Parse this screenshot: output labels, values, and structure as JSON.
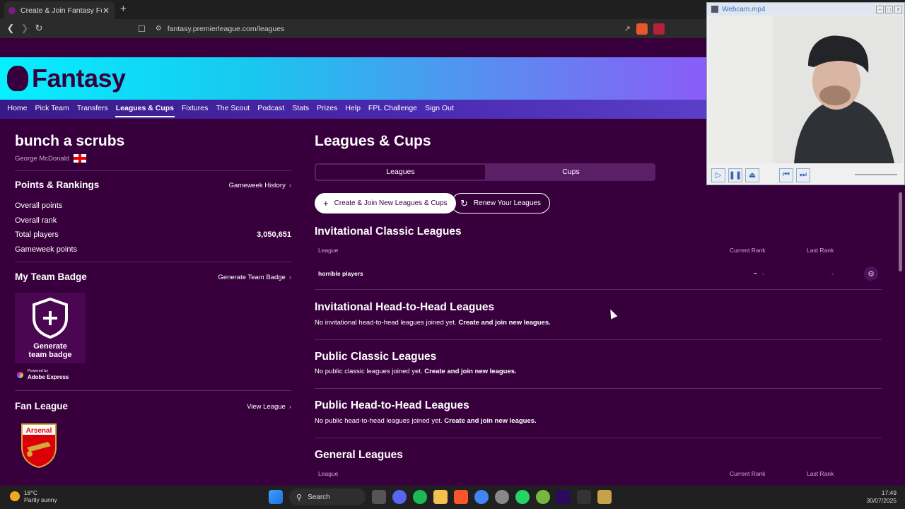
{
  "browser": {
    "tab_title": "Create & Join Fantasy Football L",
    "url": "fantasy.premierleague.com/leagues",
    "new_tab": "+",
    "close_tab": "✕"
  },
  "webcam": {
    "title": "Webcam.mp4"
  },
  "site": {
    "logo_text": "Fantasy",
    "nav": [
      "Home",
      "Pick Team",
      "Transfers",
      "Leagues & Cups",
      "Fixtures",
      "The Scout",
      "Podcast",
      "Stats",
      "Prizes",
      "Help",
      "FPL Challenge",
      "Sign Out"
    ],
    "nav_active": "Leagues & Cups",
    "brand_colors": {
      "purple": "#37003c",
      "cyan": "#05f0ff",
      "violet": "#8a5cf7"
    }
  },
  "left": {
    "team_name": "bunch a scrubs",
    "manager_name": "George McDonald",
    "points_heading": "Points & Rankings",
    "gameweek_history_link": "Gameweek History",
    "stats": [
      {
        "label": "Overall points",
        "value": ""
      },
      {
        "label": "Overall rank",
        "value": ""
      },
      {
        "label": "Total players",
        "value": "3,050,651"
      },
      {
        "label": "Gameweek points",
        "value": ""
      }
    ],
    "badge_heading": "My Team Badge",
    "badge_link": "Generate Team Badge",
    "badge_label_1": "Generate",
    "badge_label_2": "team badge",
    "adobe_1": "Powered by",
    "adobe_2": "Adobe Express",
    "fan_heading": "Fan League",
    "fan_link": "View League",
    "crest_text": "Arsenal"
  },
  "main": {
    "title": "Leagues & Cups",
    "tabs": [
      "Leagues",
      "Cups"
    ],
    "create_button": "Create & Join New Leagues & Cups",
    "renew_button": "Renew Your Leagues",
    "invitational_classic": {
      "heading": "Invitational Classic Leagues",
      "col_league": "League",
      "col_current": "Current Rank",
      "col_last": "Last Rank",
      "rows": [
        {
          "name": "horrible players",
          "current": "–",
          "current_change": "-",
          "last": "-"
        }
      ]
    },
    "invitational_h2h": {
      "heading": "Invitational Head-to-Head Leagues",
      "note": "No invitational head-to-head leagues joined yet.",
      "link": "Create and join new leagues."
    },
    "public_classic": {
      "heading": "Public Classic Leagues",
      "note": "No public classic leagues joined yet.",
      "link": "Create and join new leagues."
    },
    "public_h2h": {
      "heading": "Public Head-to-Head Leagues",
      "note": "No public head-to-head leagues joined yet.",
      "link": "Create and join new leagues."
    },
    "general": {
      "heading": "General Leagues",
      "col_league": "League",
      "col_current": "Current Rank",
      "col_last": "Last Rank"
    }
  },
  "taskbar": {
    "temp": "18°C",
    "weather": "Partly sunny",
    "search": "Search",
    "time": "17:49",
    "date": "30/07/2025"
  }
}
